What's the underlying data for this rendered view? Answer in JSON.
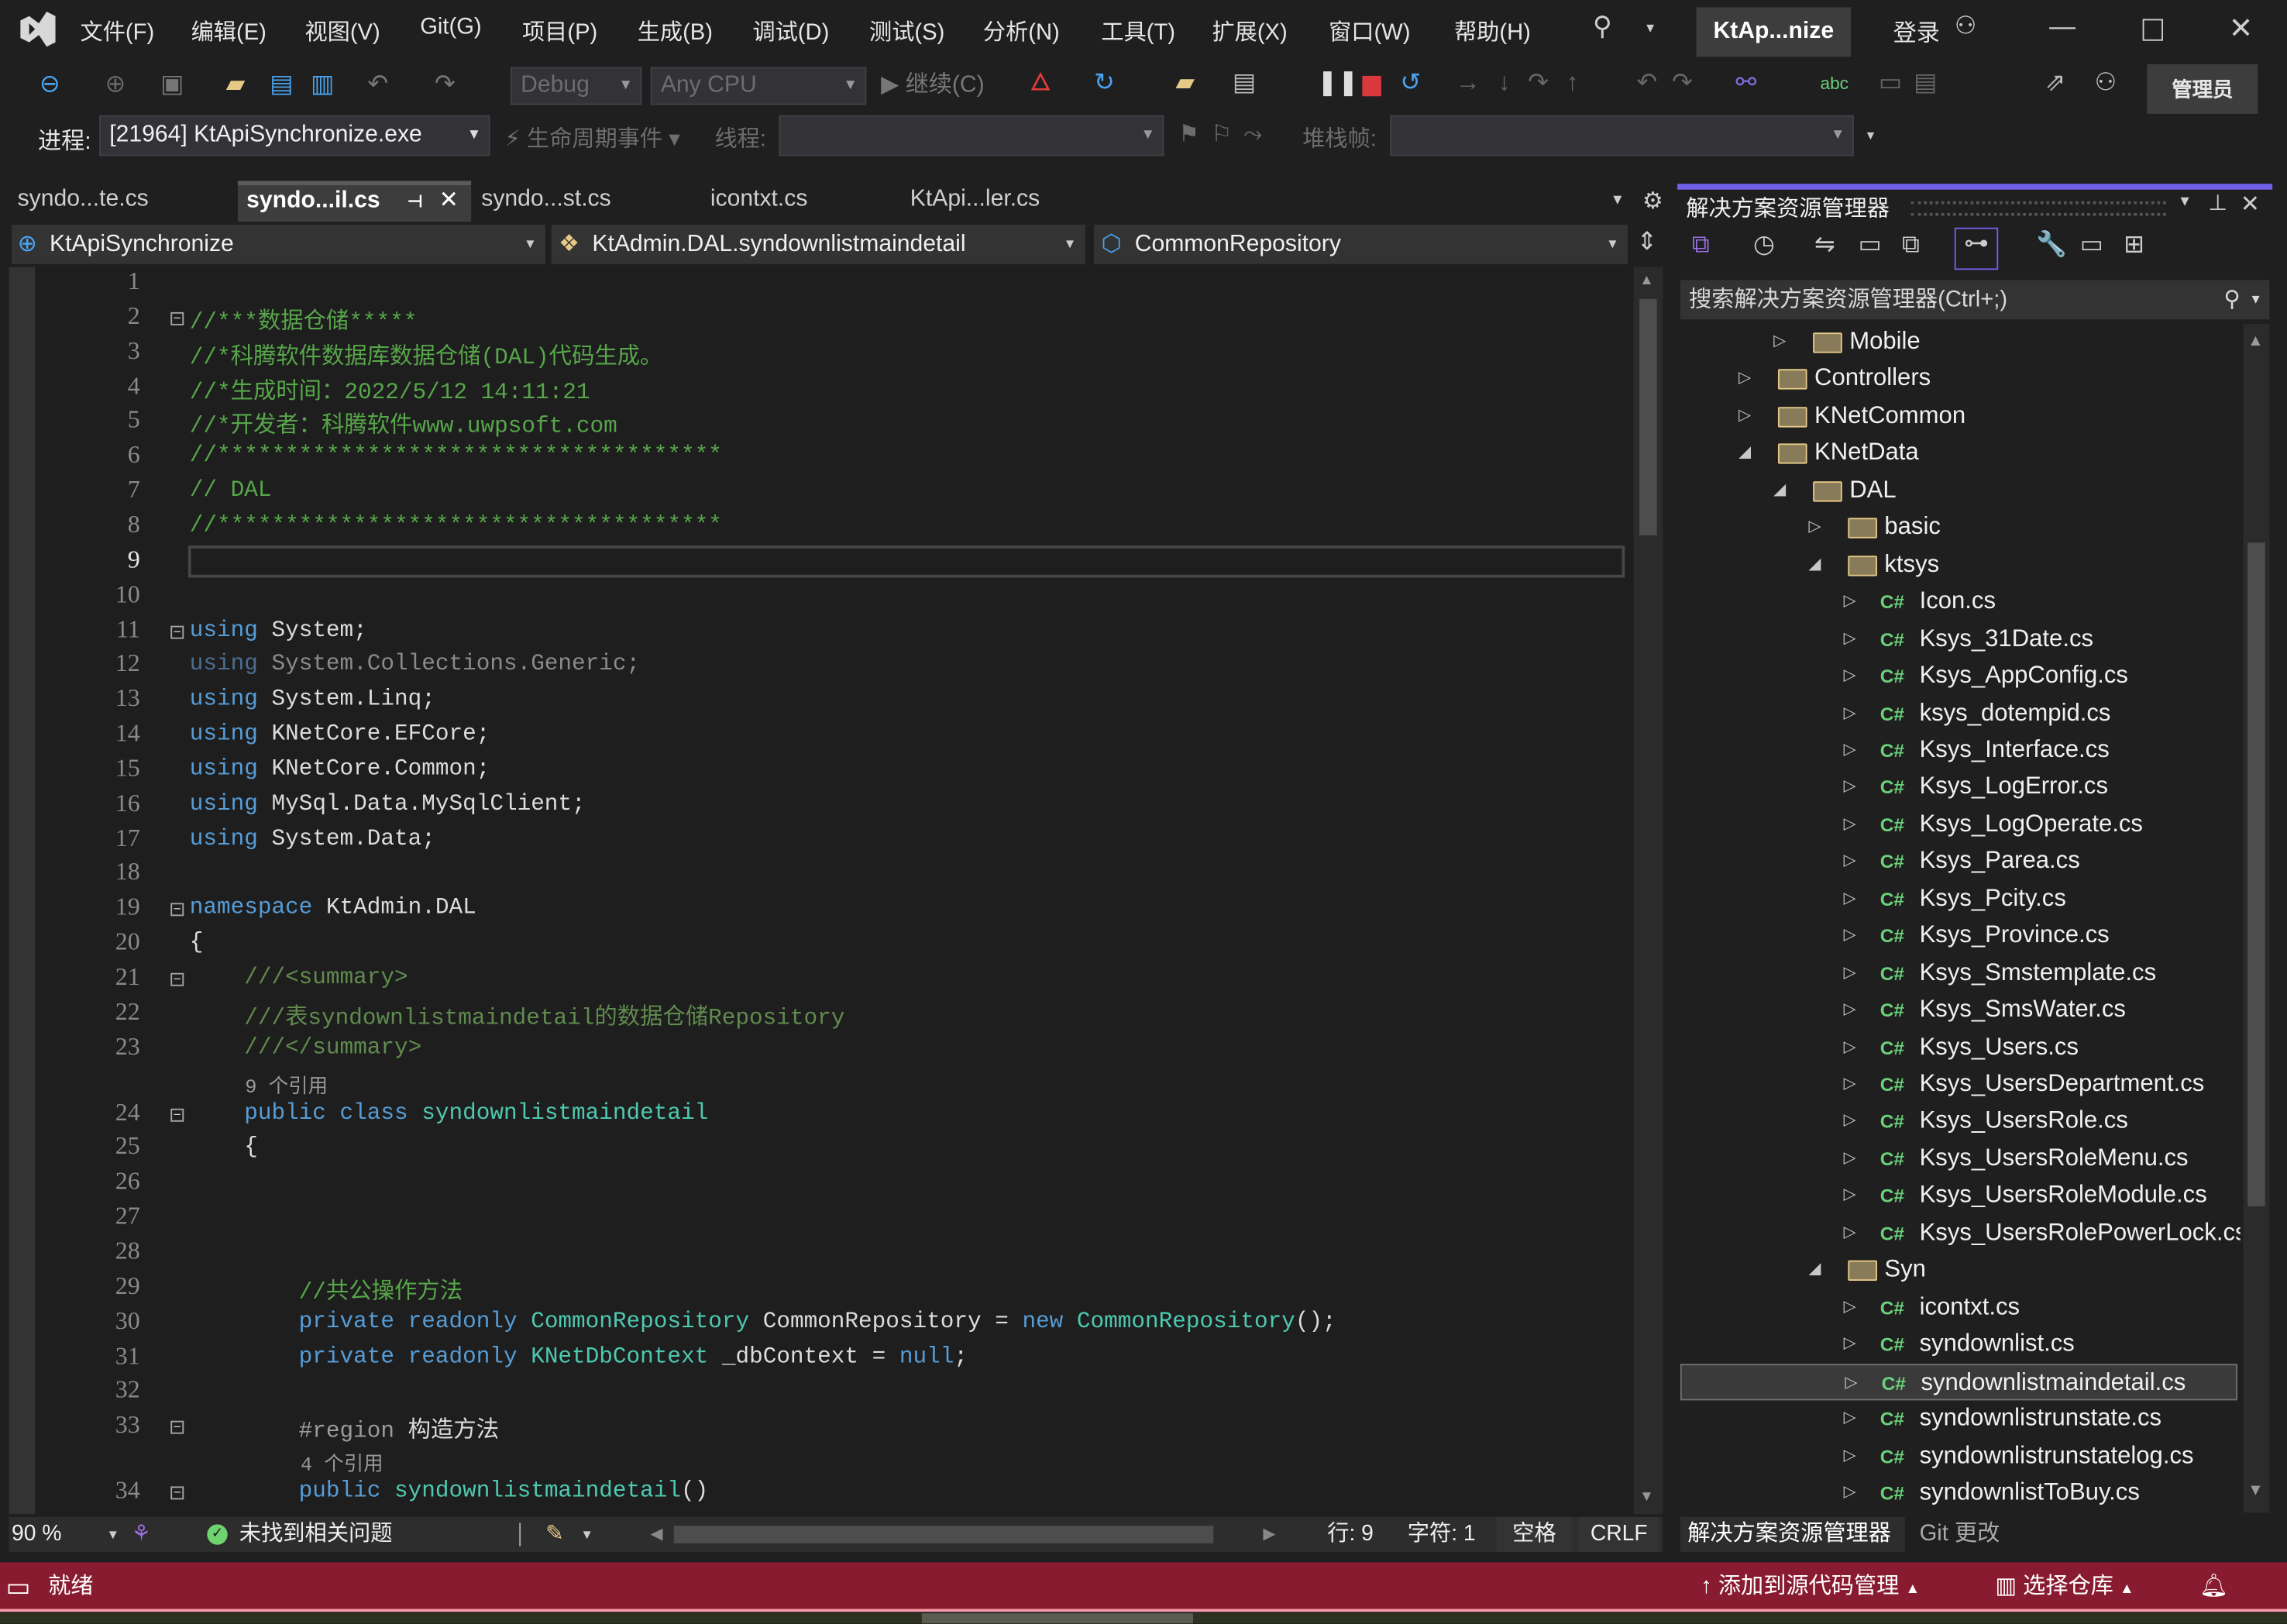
{
  "menu": {
    "items": [
      "文件(F)",
      "编辑(E)",
      "视图(V)",
      "Git(G)",
      "项目(P)",
      "生成(B)",
      "调试(D)",
      "测试(S)",
      "分析(N)",
      "工具(T)",
      "扩展(X)",
      "窗口(W)",
      "帮助(H)"
    ],
    "solution_badge": "KtAp...nize",
    "login": "登录"
  },
  "toolbar": {
    "config": "Debug",
    "platform": "Any CPU",
    "continue": "继续(C)",
    "admin": "管理员",
    "process_label": "进程:",
    "process_value": "[21964] KtApiSynchronize.exe",
    "lifecycle": "生命周期事件",
    "thread_label": "线程:",
    "stackframe_label": "堆栈帧:"
  },
  "tabs": [
    {
      "label": "syndo...te.cs",
      "active": false
    },
    {
      "label": "syndo...il.cs",
      "active": true
    },
    {
      "label": "syndo...st.cs",
      "active": false
    },
    {
      "label": "icontxt.cs",
      "active": false
    },
    {
      "label": "KtApi...ler.cs",
      "active": false
    }
  ],
  "navbar": {
    "project": "KtApiSynchronize",
    "type": "KtAdmin.DAL.syndownlistmaindetail",
    "member": "CommonRepository"
  },
  "code": [
    {
      "n": 1,
      "t": []
    },
    {
      "n": 2,
      "fold": true,
      "t": [
        [
          "cm",
          "//***数据仓储*****"
        ]
      ]
    },
    {
      "n": 3,
      "t": [
        [
          "cm",
          "//*科腾软件数据库数据仓储(DAL)代码生成。"
        ]
      ]
    },
    {
      "n": 4,
      "t": [
        [
          "cm",
          "//*生成时间：2022/5/12 14:11:21"
        ]
      ]
    },
    {
      "n": 5,
      "t": [
        [
          "cm",
          "//*开发者：科腾软件www.uwpsoft.com"
        ]
      ]
    },
    {
      "n": 6,
      "t": [
        [
          "cm",
          "//*************************************"
        ]
      ]
    },
    {
      "n": 7,
      "t": [
        [
          "cm",
          "// DAL"
        ]
      ]
    },
    {
      "n": 8,
      "t": [
        [
          "cm",
          "//*************************************"
        ]
      ]
    },
    {
      "n": 9,
      "current": true,
      "t": []
    },
    {
      "n": 10,
      "t": []
    },
    {
      "n": 11,
      "fold": true,
      "t": [
        [
          "kw",
          "using"
        ],
        [
          "tx",
          " System;"
        ]
      ]
    },
    {
      "n": 12,
      "t": [
        [
          "dimkw",
          "using"
        ],
        [
          "dim",
          " System.Collections.Generic;"
        ]
      ]
    },
    {
      "n": 13,
      "t": [
        [
          "kw",
          "using"
        ],
        [
          "tx",
          " System.Linq;"
        ]
      ]
    },
    {
      "n": 14,
      "t": [
        [
          "kw",
          "using"
        ],
        [
          "tx",
          " KNetCore.EFCore;"
        ]
      ]
    },
    {
      "n": 15,
      "t": [
        [
          "kw",
          "using"
        ],
        [
          "tx",
          " KNetCore.Common;"
        ]
      ]
    },
    {
      "n": 16,
      "t": [
        [
          "kw",
          "using"
        ],
        [
          "tx",
          " MySql.Data.MySqlClient;"
        ]
      ]
    },
    {
      "n": 17,
      "t": [
        [
          "kw",
          "using"
        ],
        [
          "tx",
          " System.Data;"
        ]
      ]
    },
    {
      "n": 18,
      "t": []
    },
    {
      "n": 19,
      "fold": true,
      "t": [
        [
          "kw",
          "namespace"
        ],
        [
          "tx",
          " KtAdmin.DAL"
        ]
      ]
    },
    {
      "n": 20,
      "t": [
        [
          "tx",
          "{"
        ]
      ]
    },
    {
      "n": 21,
      "fold": true,
      "t": [
        [
          "xml",
          "    ///<summary>"
        ]
      ]
    },
    {
      "n": 22,
      "t": [
        [
          "xml",
          "    ///表syndownlistmaindetail的数据仓储Repository"
        ]
      ]
    },
    {
      "n": 23,
      "t": [
        [
          "xml",
          "    ///</summary>"
        ]
      ]
    },
    {
      "lens": "9 个引用",
      "indent": "    "
    },
    {
      "n": 24,
      "fold": true,
      "t": [
        [
          "kw",
          "    public class "
        ],
        [
          "ty",
          "syndownlistmaindetail"
        ]
      ]
    },
    {
      "n": 25,
      "t": [
        [
          "tx",
          "    {"
        ]
      ]
    },
    {
      "n": 26,
      "t": []
    },
    {
      "n": 27,
      "t": []
    },
    {
      "n": 28,
      "t": []
    },
    {
      "n": 29,
      "t": [
        [
          "cm",
          "        //共公操作方法"
        ]
      ]
    },
    {
      "n": 30,
      "t": [
        [
          "kw",
          "        private readonly "
        ],
        [
          "ty",
          "CommonRepository"
        ],
        [
          "tx",
          " CommonRepository = "
        ],
        [
          "kw",
          "new "
        ],
        [
          "ty",
          "CommonRepository"
        ],
        [
          "tx",
          "();"
        ]
      ]
    },
    {
      "n": 31,
      "t": [
        [
          "kw",
          "        private readonly "
        ],
        [
          "ty",
          "KNetDbContext"
        ],
        [
          "tx",
          " _dbContext = "
        ],
        [
          "kw",
          "null"
        ],
        [
          "tx",
          ";"
        ]
      ]
    },
    {
      "n": 32,
      "t": []
    },
    {
      "n": 33,
      "fold": true,
      "t": [
        [
          "pre",
          "        #region "
        ],
        [
          "cjk",
          "构造方法"
        ]
      ]
    },
    {
      "lens": "4 个引用",
      "indent": "        "
    },
    {
      "n": 34,
      "fold": true,
      "t": [
        [
          "kw",
          "        public "
        ],
        [
          "ty",
          "syndownlistmaindetail"
        ],
        [
          "tx",
          "()"
        ]
      ]
    },
    {
      "n": 35,
      "t": [
        [
          "tx",
          "        {"
        ]
      ]
    }
  ],
  "editor_status": {
    "zoom": "90 %",
    "issues": "未找到相关问题",
    "line": "行: 9",
    "char": "字符: 1",
    "spaces": "空格",
    "eol": "CRLF"
  },
  "solution_explorer": {
    "title": "解决方案资源管理器",
    "search_placeholder": "搜索解决方案资源管理器(Ctrl+;)",
    "items": [
      {
        "label": "Mobile",
        "kind": "folder",
        "level": 1,
        "state": "collapsed"
      },
      {
        "label": "Controllers",
        "kind": "folder",
        "level": 0,
        "state": "collapsed"
      },
      {
        "label": "KNetCommon",
        "kind": "folder",
        "level": 0,
        "state": "collapsed"
      },
      {
        "label": "KNetData",
        "kind": "folder",
        "level": 0,
        "state": "expanded"
      },
      {
        "label": "DAL",
        "kind": "folder",
        "level": 1,
        "state": "expanded"
      },
      {
        "label": "basic",
        "kind": "folder",
        "level": 2,
        "state": "collapsed"
      },
      {
        "label": "ktsys",
        "kind": "folder",
        "level": 2,
        "state": "expanded"
      },
      {
        "label": "Icon.cs",
        "kind": "cs",
        "level": 3,
        "state": "collapsed"
      },
      {
        "label": "Ksys_31Date.cs",
        "kind": "cs",
        "level": 3,
        "state": "collapsed"
      },
      {
        "label": "Ksys_AppConfig.cs",
        "kind": "cs",
        "level": 3,
        "state": "collapsed"
      },
      {
        "label": "ksys_dotempid.cs",
        "kind": "cs",
        "level": 3,
        "state": "collapsed"
      },
      {
        "label": "Ksys_Interface.cs",
        "kind": "cs",
        "level": 3,
        "state": "collapsed"
      },
      {
        "label": "Ksys_LogError.cs",
        "kind": "cs",
        "level": 3,
        "state": "collapsed"
      },
      {
        "label": "Ksys_LogOperate.cs",
        "kind": "cs",
        "level": 3,
        "state": "collapsed"
      },
      {
        "label": "Ksys_Parea.cs",
        "kind": "cs",
        "level": 3,
        "state": "collapsed"
      },
      {
        "label": "Ksys_Pcity.cs",
        "kind": "cs",
        "level": 3,
        "state": "collapsed"
      },
      {
        "label": "Ksys_Province.cs",
        "kind": "cs",
        "level": 3,
        "state": "collapsed"
      },
      {
        "label": "Ksys_Smstemplate.cs",
        "kind": "cs",
        "level": 3,
        "state": "collapsed"
      },
      {
        "label": "Ksys_SmsWater.cs",
        "kind": "cs",
        "level": 3,
        "state": "collapsed"
      },
      {
        "label": "Ksys_Users.cs",
        "kind": "cs",
        "level": 3,
        "state": "collapsed"
      },
      {
        "label": "Ksys_UsersDepartment.cs",
        "kind": "cs",
        "level": 3,
        "state": "collapsed"
      },
      {
        "label": "Ksys_UsersRole.cs",
        "kind": "cs",
        "level": 3,
        "state": "collapsed"
      },
      {
        "label": "Ksys_UsersRoleMenu.cs",
        "kind": "cs",
        "level": 3,
        "state": "collapsed"
      },
      {
        "label": "Ksys_UsersRoleModule.cs",
        "kind": "cs",
        "level": 3,
        "state": "collapsed"
      },
      {
        "label": "Ksys_UsersRolePowerLock.cs",
        "kind": "cs",
        "level": 3,
        "state": "collapsed"
      },
      {
        "label": "Syn",
        "kind": "folder",
        "level": 2,
        "state": "expanded"
      },
      {
        "label": "icontxt.cs",
        "kind": "cs",
        "level": 3,
        "state": "collapsed"
      },
      {
        "label": "syndownlist.cs",
        "kind": "cs",
        "level": 3,
        "state": "collapsed"
      },
      {
        "label": "syndownlistmaindetail.cs",
        "kind": "cs",
        "level": 3,
        "state": "collapsed",
        "selected": true
      },
      {
        "label": "syndownlistrunstate.cs",
        "kind": "cs",
        "level": 3,
        "state": "collapsed"
      },
      {
        "label": "syndownlistrunstatelog.cs",
        "kind": "cs",
        "level": 3,
        "state": "collapsed"
      },
      {
        "label": "syndownlistToBuy.cs",
        "kind": "cs",
        "level": 3,
        "state": "collapsed"
      }
    ],
    "bottom_tabs": [
      "解决方案资源管理器",
      "Git 更改"
    ],
    "cs_badge": "C#"
  },
  "statusbar": {
    "ready": "就绪",
    "add_source_control": "添加到源代码管理",
    "select_repo": "选择仓库"
  },
  "colors": {
    "statusbar": "#891b30",
    "accent": "#7160e8",
    "comment": "#57a64a",
    "keyword": "#569cd6",
    "type": "#4ec9b0"
  }
}
